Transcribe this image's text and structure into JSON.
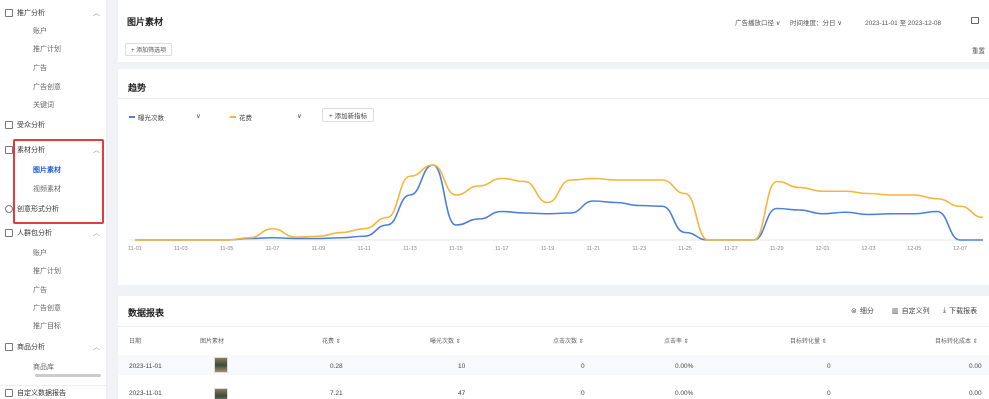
{
  "sidebar": {
    "groups": [
      {
        "label": "推广分析",
        "items": [
          "账户",
          "推广计划",
          "广告",
          "广告创意",
          "关键词"
        ]
      },
      {
        "label": "受众分析",
        "items": []
      },
      {
        "label": "素材分析",
        "items": [
          "图片素材",
          "视频素材"
        ]
      },
      {
        "label": "创意形式分析",
        "items": []
      },
      {
        "label": "人群包分析",
        "items": [
          "账户",
          "推广计划",
          "广告",
          "广告创意",
          "推广目标"
        ]
      },
      {
        "label": "商品分析",
        "items": [
          "商品库"
        ]
      },
      {
        "label": "自定义数据报告",
        "items": []
      }
    ],
    "active_item": "图片素材"
  },
  "header": {
    "title": "图片素材",
    "scope": "广告播放口径",
    "granularity": "时间维度：分日",
    "date_range": "2023-11-01 至 2023-12-08",
    "add_filter": "+ 添加筛选项",
    "reset": "重置"
  },
  "trend": {
    "title": "趋势",
    "metric1": "曝光次数",
    "metric2": "花费",
    "add_metric": "+ 添加新指标"
  },
  "colors": {
    "exposure": "#4a7fe0",
    "cost": "#f5b63c",
    "active": "#1e5fd9",
    "highlight": "#e23b3b"
  },
  "chart_data": {
    "type": "line",
    "x": [
      "11-01",
      "11-02",
      "11-03",
      "11-04",
      "11-05",
      "11-06",
      "11-07",
      "11-08",
      "11-09",
      "11-10",
      "11-11",
      "11-12",
      "11-13",
      "11-14",
      "11-15",
      "11-16",
      "11-17",
      "11-18",
      "11-19",
      "11-20",
      "11-21",
      "11-22",
      "11-23",
      "11-24",
      "11-25",
      "11-26",
      "11-27",
      "11-28",
      "11-29",
      "11-30",
      "12-01",
      "12-02",
      "12-03",
      "12-04",
      "12-05",
      "12-06",
      "12-07",
      "12-08"
    ],
    "tick_labels": [
      "11-01",
      "11-03",
      "11-05",
      "11-07",
      "11-09",
      "11-11",
      "11-13",
      "11-15",
      "11-17",
      "11-19",
      "11-21",
      "11-23",
      "11-25",
      "11-27",
      "11-29",
      "12-01",
      "12-03",
      "12-05",
      "12-07"
    ],
    "series": [
      {
        "name": "曝光次数",
        "values": [
          0,
          0,
          0,
          0,
          0,
          2,
          3,
          2,
          2,
          3,
          5,
          20,
          60,
          100,
          20,
          28,
          38,
          36,
          35,
          36,
          52,
          50,
          46,
          45,
          10,
          0,
          0,
          0,
          42,
          40,
          35,
          37,
          34,
          35,
          35,
          38,
          0,
          0
        ]
      },
      {
        "name": "花费",
        "values": [
          0,
          0,
          0,
          0,
          0,
          3,
          15,
          4,
          5,
          10,
          15,
          30,
          85,
          100,
          60,
          72,
          82,
          78,
          50,
          80,
          82,
          80,
          80,
          80,
          62,
          0,
          0,
          0,
          78,
          70,
          65,
          65,
          62,
          60,
          60,
          55,
          45,
          30
        ]
      }
    ],
    "xlabel": "",
    "ylabel": "",
    "grid": false,
    "legend": "top-left"
  },
  "table": {
    "title": "数据报表",
    "tools": [
      "细分",
      "自定义列",
      "下载报表"
    ],
    "headers": [
      "日期",
      "图片素材",
      "花费 ⇕",
      "曝光次数 ⇕",
      "点击次数 ⇕",
      "点击率 ⇕",
      "目标转化量 ⇕",
      "目标转化成本 ⇕"
    ],
    "rows": [
      [
        "2023-11-01",
        "",
        "0.28",
        "10",
        "0",
        "0.00%",
        "0",
        "0.00"
      ],
      [
        "2023-11-01",
        "",
        "7.21",
        "47",
        "0",
        "0.00%",
        "0",
        "0.00"
      ]
    ]
  }
}
